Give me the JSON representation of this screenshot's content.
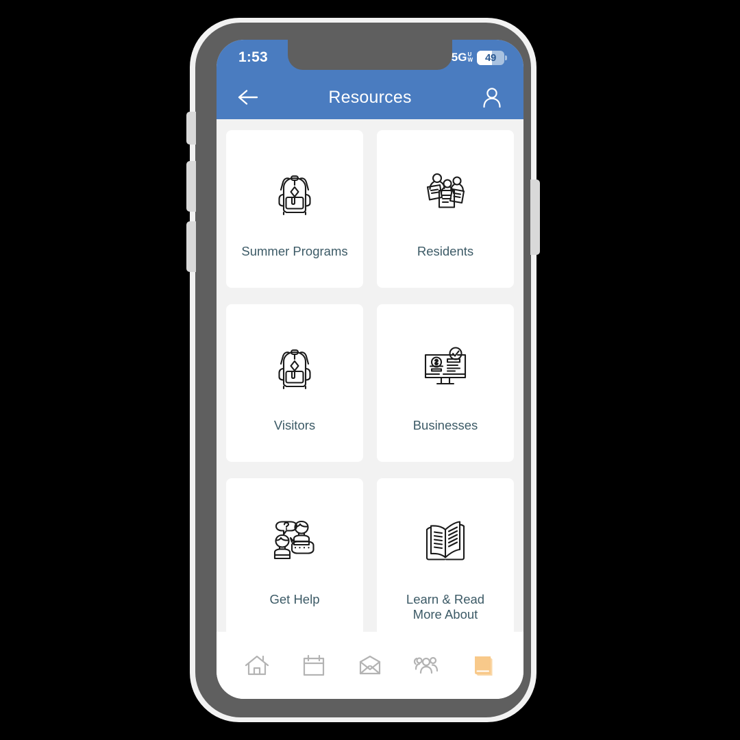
{
  "status_bar": {
    "time": "1:53",
    "network": "5G",
    "network_sub_top": "U",
    "network_sub_bottom": "W",
    "battery_level": "49",
    "signal_icon": "signal-bars-icon"
  },
  "app_bar": {
    "back_icon": "arrow-left-icon",
    "title": "Resources",
    "profile_icon": "person-icon"
  },
  "cards": [
    {
      "label": "Summer Programs",
      "icon": "backpack-icon"
    },
    {
      "label": "Residents",
      "icon": "people-documents-icon"
    },
    {
      "label": "Visitors",
      "icon": "backpack-icon"
    },
    {
      "label": "Businesses",
      "icon": "monitor-money-check-icon"
    },
    {
      "label": "Get Help",
      "icon": "people-chat-question-icon"
    },
    {
      "label": "Learn & Read\nMore About",
      "icon": "open-book-icon"
    }
  ],
  "bottom_nav": [
    {
      "icon": "home-icon",
      "active": false
    },
    {
      "icon": "calendar-icon",
      "active": false
    },
    {
      "icon": "mail-icon",
      "active": false
    },
    {
      "icon": "group-icon",
      "active": false
    },
    {
      "icon": "book-icon",
      "active": true
    }
  ],
  "colors": {
    "header_blue": "#4A7CC0",
    "screen_background": "#F2F2F2",
    "card_background": "#FFFFFF",
    "label_text": "#3C5A66",
    "nav_inactive": "#B3B3B3",
    "nav_active": "#F8C98A",
    "icon_stroke": "#1A1A1A"
  }
}
